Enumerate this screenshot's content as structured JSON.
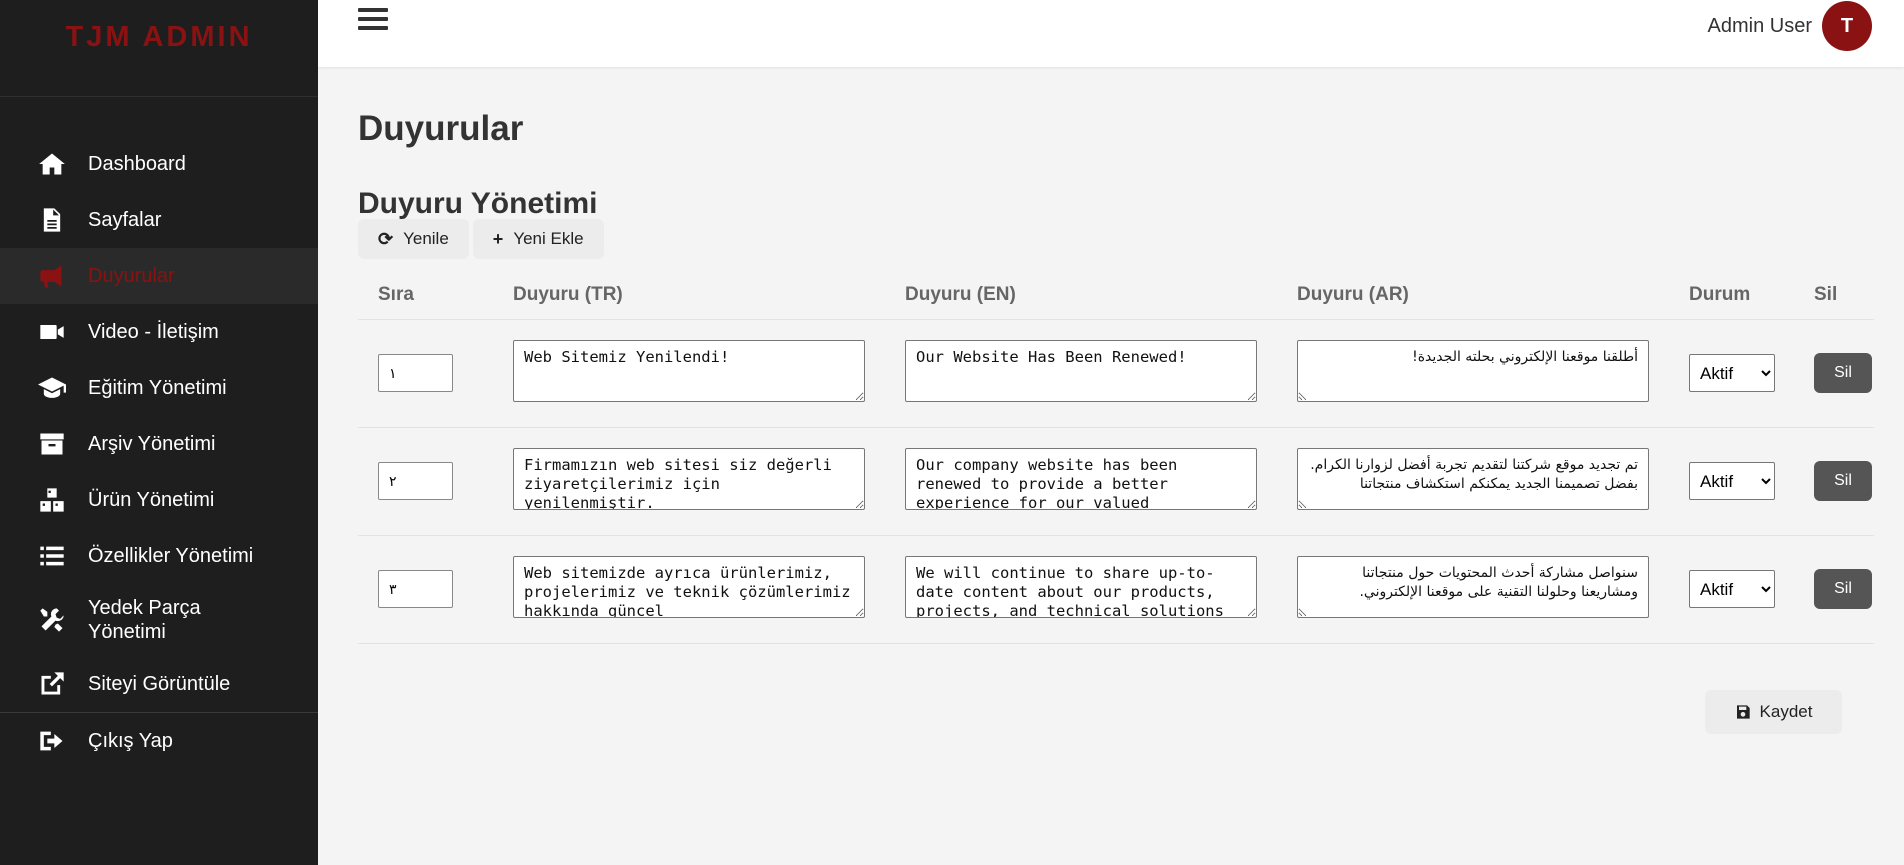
{
  "brand": "TJM ADMIN",
  "nav": [
    {
      "label": "Dashboard",
      "icon": "home-icon"
    },
    {
      "label": "Sayfalar",
      "icon": "file-icon"
    },
    {
      "label": "Duyurular",
      "icon": "megaphone-icon",
      "active": true
    },
    {
      "label": "Video - İletişim",
      "icon": "video-icon"
    },
    {
      "label": "Eğitim Yönetimi",
      "icon": "graduation-cap-icon"
    },
    {
      "label": "Arşiv Yönetimi",
      "icon": "archive-icon"
    },
    {
      "label": "Ürün Yönetimi",
      "icon": "cubes-icon"
    },
    {
      "label": "Özellikler Yönetimi",
      "icon": "list-icon"
    },
    {
      "label": "Yedek Parça Yönetimi",
      "icon": "tools-icon"
    },
    {
      "label": "Siteyi Görüntüle",
      "icon": "external-link-icon"
    },
    {
      "label": "Çıkış Yap",
      "icon": "sign-out-icon"
    }
  ],
  "header": {
    "user_name": "Admin User",
    "avatar_letter": "T"
  },
  "main": {
    "page_title": "Duyurular",
    "section_title": "Duyuru Yönetimi",
    "refresh_label": "Yenile",
    "add_label": "Yeni Ekle",
    "save_label": "Kaydet"
  },
  "table": {
    "headers": [
      "Sıra",
      "Duyuru (TR)",
      "Duyuru (EN)",
      "Duyuru (AR)",
      "Durum",
      "Sil"
    ],
    "rows": [
      {
        "order": "١",
        "tr": "Web Sitemiz Yenilendi!",
        "en": "Our Website Has Been Renewed!",
        "ar": "أطلقنا موقعنا الإلكتروني بحلته الجديدة!",
        "status": "Aktif",
        "delete": "Sil"
      },
      {
        "order": "٢",
        "tr": "Firmamızın web sitesi siz değerli ziyaretçilerimiz için yenilenmiştir.",
        "en": "Our company website has been renewed to provide a better experience for our valued",
        "ar": "تم تجديد موقع شركتنا لتقديم تجربة أفضل لزوارنا الكرام. بفضل تصميمنا الجديد يمكنكم استكشاف منتجاتنا",
        "status": "Aktif",
        "delete": "Sil"
      },
      {
        "order": "٣",
        "tr": "Web sitemizde ayrıca ürünlerimiz, projelerimiz ve teknik çözümlerimiz hakkında güncel",
        "en": "We will continue to share up-to-date content about our products, projects, and technical solutions",
        "ar": "سنواصل مشاركة أحدث المحتويات حول منتجاتنا ومشاريعنا وحلولنا التقنية على موقعنا الإلكتروني.",
        "status": "Aktif",
        "delete": "Sil"
      }
    ],
    "status_options": [
      "Aktif"
    ]
  },
  "colors": {
    "brand": "#8b1212",
    "sidebar_bg": "#1e1e1e",
    "delete_button": "#555555"
  }
}
